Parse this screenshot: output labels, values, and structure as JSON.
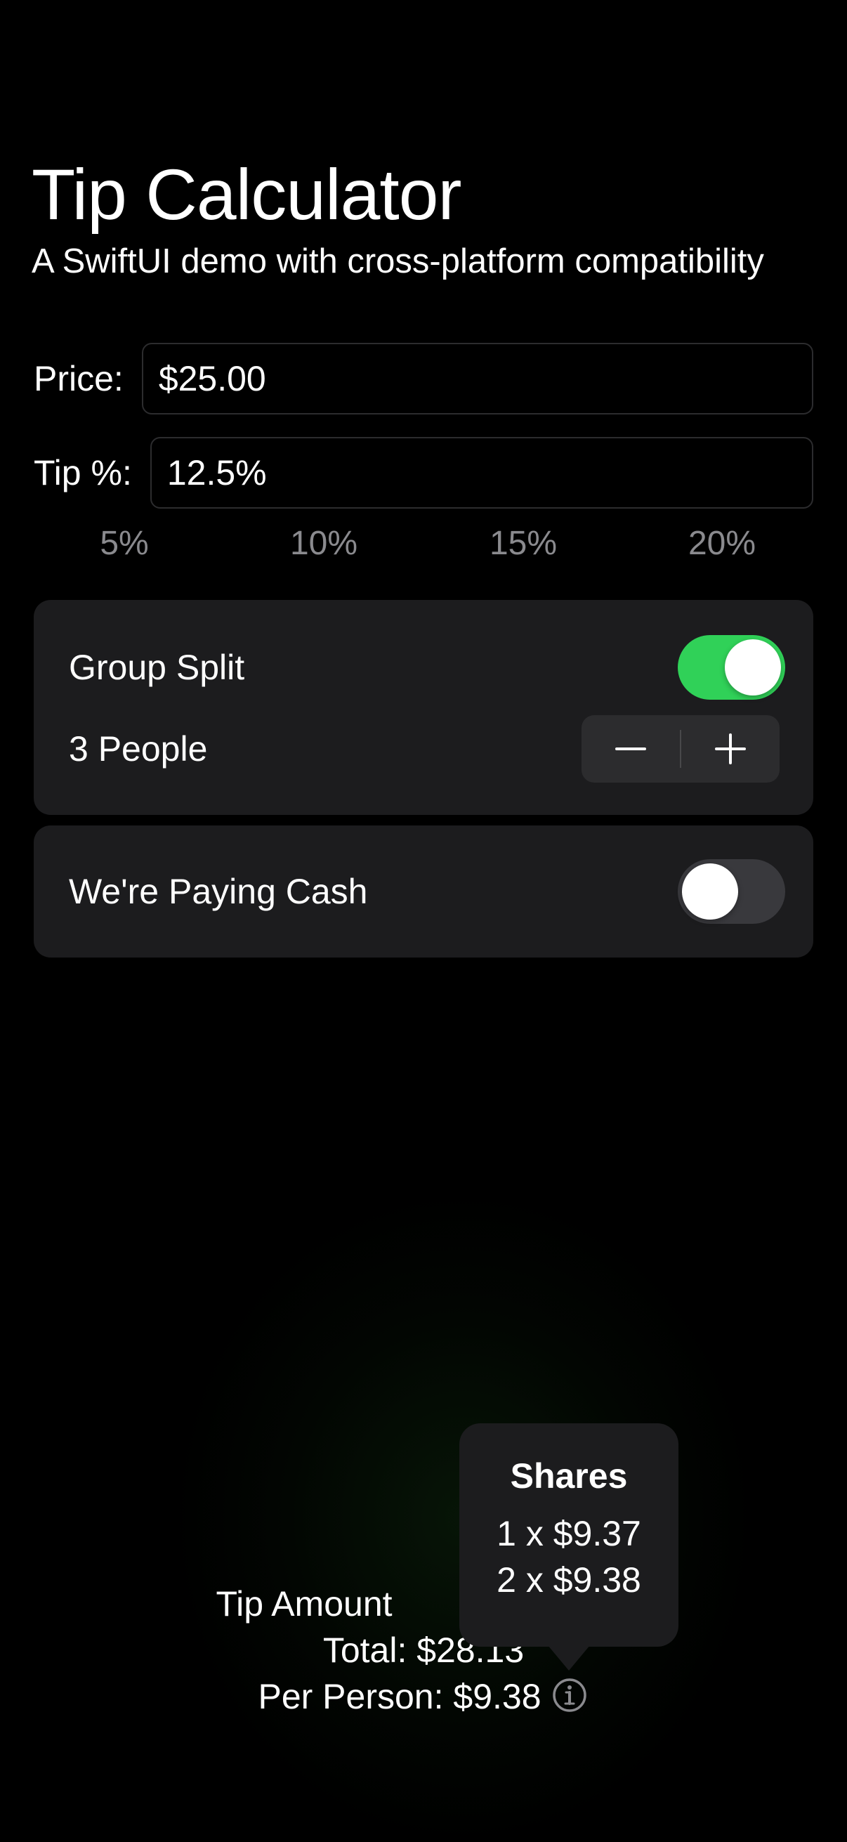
{
  "header": {
    "title": "Tip Calculator",
    "subtitle": "A SwiftUI demo with cross-platform compatibility"
  },
  "price": {
    "label": "Price:",
    "value": "$25.00"
  },
  "tip": {
    "label": "Tip %:",
    "value": "12.5%"
  },
  "tip_presets": [
    "5%",
    "10%",
    "15%",
    "20%"
  ],
  "group_split": {
    "label": "Group Split",
    "enabled": true,
    "people_label": "3 People"
  },
  "cash": {
    "label": "We're Paying Cash",
    "enabled": false
  },
  "results": {
    "tip_amount_label": "Tip Amount",
    "total": "Total: $28.13",
    "per_person": "Per Person: $9.38"
  },
  "shares_popover": {
    "title": "Shares",
    "lines": [
      "1 x $9.37",
      "2 x $9.38"
    ]
  },
  "colors": {
    "toggle_on": "#30d158",
    "card": "#1c1c1e",
    "preset_text": "#8a8a8e"
  }
}
